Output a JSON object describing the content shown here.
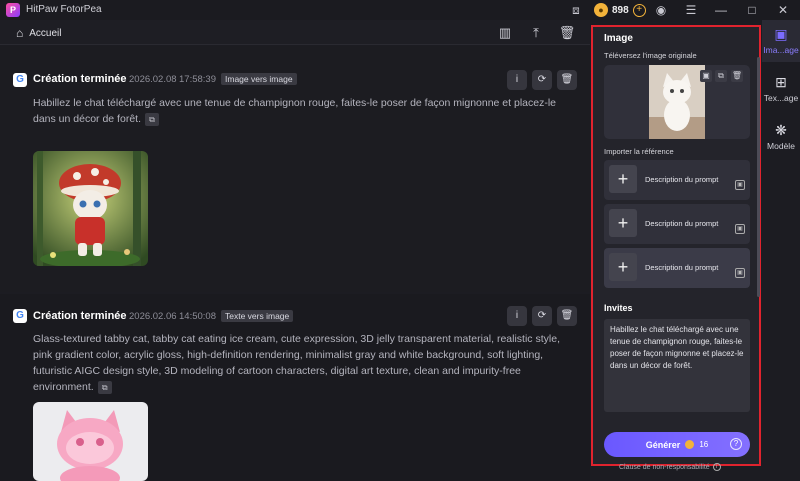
{
  "app": {
    "title": "HitPaw FotorPea",
    "logo_letter": "P",
    "credits": "898"
  },
  "header": {
    "home_label": "Accueil"
  },
  "icons": {
    "home": "⌂",
    "book": "▥",
    "upload": "⤒",
    "trash": "🗑",
    "info": "i",
    "refresh": "⟳",
    "copy": "⧉",
    "plus": "+",
    "help": "?",
    "user": "◉",
    "menu": "☰",
    "minimize": "—",
    "maximize": "□",
    "close": "✕",
    "window": "⧈"
  },
  "feed": {
    "cards": [
      {
        "status": "Création terminée",
        "date": "2026.02.08",
        "time": "17:58:39",
        "badge": "Image vers image",
        "prompt": "Habillez le chat téléchargé avec une tenue de champignon rouge, faites-le poser de façon mignonne et placez-le dans un décor de forêt."
      },
      {
        "status": "Création terminée",
        "date": "2026.02.06",
        "time": "14:50:08",
        "badge": "Texte vers image",
        "prompt": "Glass-textured tabby cat, tabby cat eating ice cream, cute expression, 3D jelly transparent material, realistic style, pink gradient color, acrylic gloss, high-definition rendering, minimalist gray and white background, soft lighting, futuristic AIGC design style, 3D modeling of cartoon characters, digital art texture, clean and impurity-free environment."
      }
    ]
  },
  "panel": {
    "title": "Image",
    "upload_label": "Téléversez l'image originale",
    "reference_label": "Importer la référence",
    "reference_items": [
      "Description du prompt",
      "Description du prompt",
      "Description du prompt"
    ],
    "invites_title": "Invites",
    "invites_text": "Habillez le chat téléchargé avec une tenue de champignon rouge, faites-le poser de façon mignonne et placez-le dans un décor de forêt.",
    "generate_label": "Générer",
    "generate_cost": "16",
    "disclaimer": "Clause de non-responsabilité"
  },
  "sidebar": {
    "tabs": [
      {
        "label": "Ima...age",
        "icon": "▣",
        "active": true
      },
      {
        "label": "Tex...age",
        "icon": "⊞",
        "active": false
      },
      {
        "label": "Modèle",
        "icon": "❋",
        "active": false
      }
    ]
  },
  "colors": {
    "accent": "#7b6cff",
    "highlight_border": "#e0232e",
    "coin": "#f3b33a"
  }
}
